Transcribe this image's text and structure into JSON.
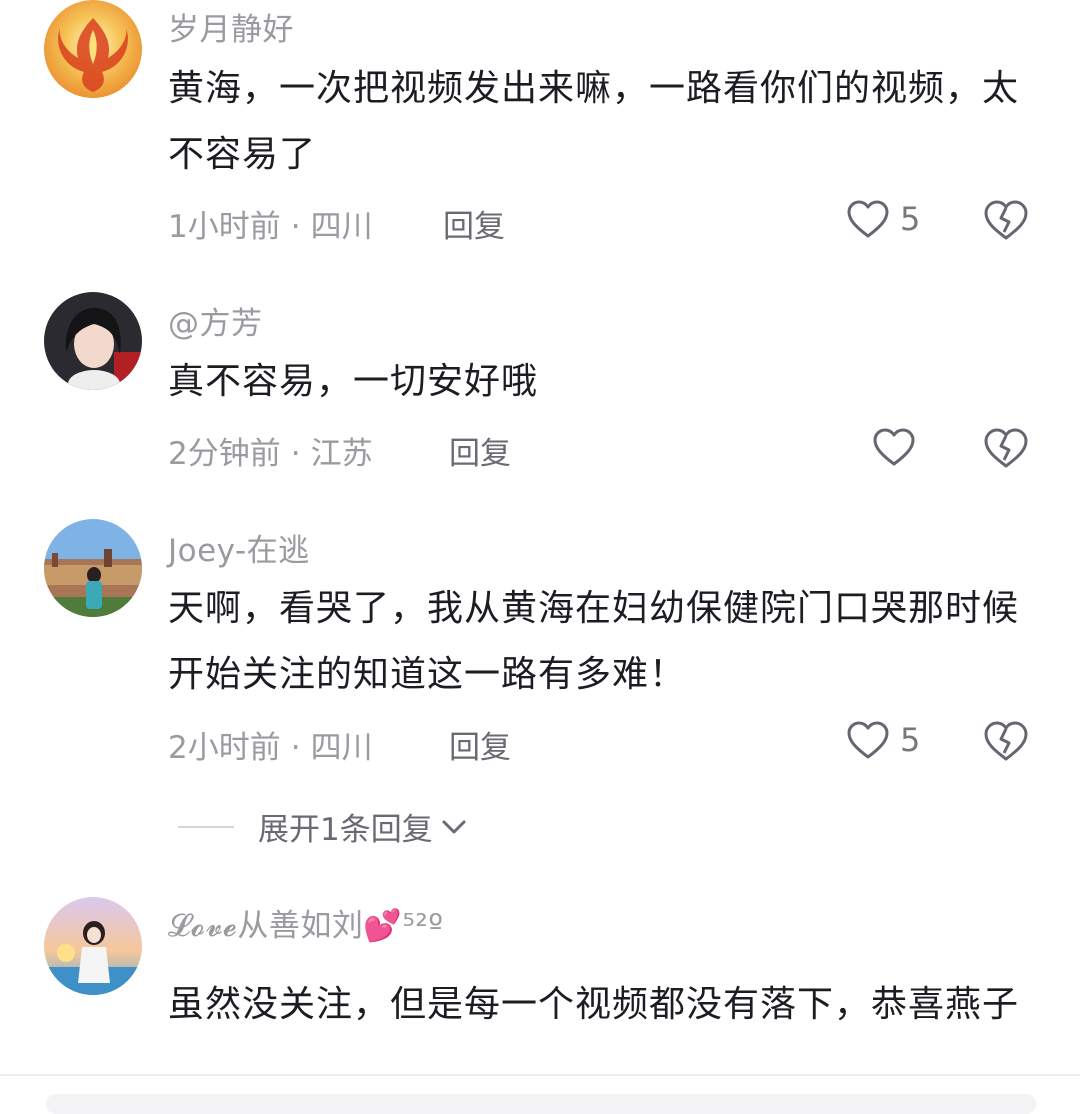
{
  "comments": [
    {
      "username": "岁月静好",
      "text": "黄海，一次把视频发出来嘛，一路看你们的视频，太不容易了",
      "time": "1小时前",
      "location": "四川",
      "reply_label": "回复",
      "likes": "5",
      "avatar_icon": "phoenix-avatar"
    },
    {
      "username": "@方芳",
      "text": "真不容易，一切安好哦",
      "time": "2分钟前",
      "location": "江苏",
      "reply_label": "回复",
      "likes": "",
      "avatar_icon": "woman-portrait-avatar"
    },
    {
      "username": "Joey-在逃",
      "text": "天啊，看哭了，我从黄海在妇幼保健院门口哭那时候开始关注的知道这一路有多难！",
      "time": "2小时前",
      "location": "四川",
      "reply_label": "回复",
      "likes": "5",
      "avatar_icon": "travel-photo-avatar",
      "expand_label": "展开1条回复"
    },
    {
      "username": "𝓛𝓸𝓿𝓮从善如刘💕⁵²º",
      "text": "虽然没关注，但是每一个视频都没有落下，恭喜燕子",
      "avatar_icon": "anime-girl-sunset-avatar"
    }
  ],
  "meta_separator": "·",
  "colors": {
    "meta": "#9a9aa0",
    "text": "#1c1c22",
    "icon": "#666670"
  }
}
